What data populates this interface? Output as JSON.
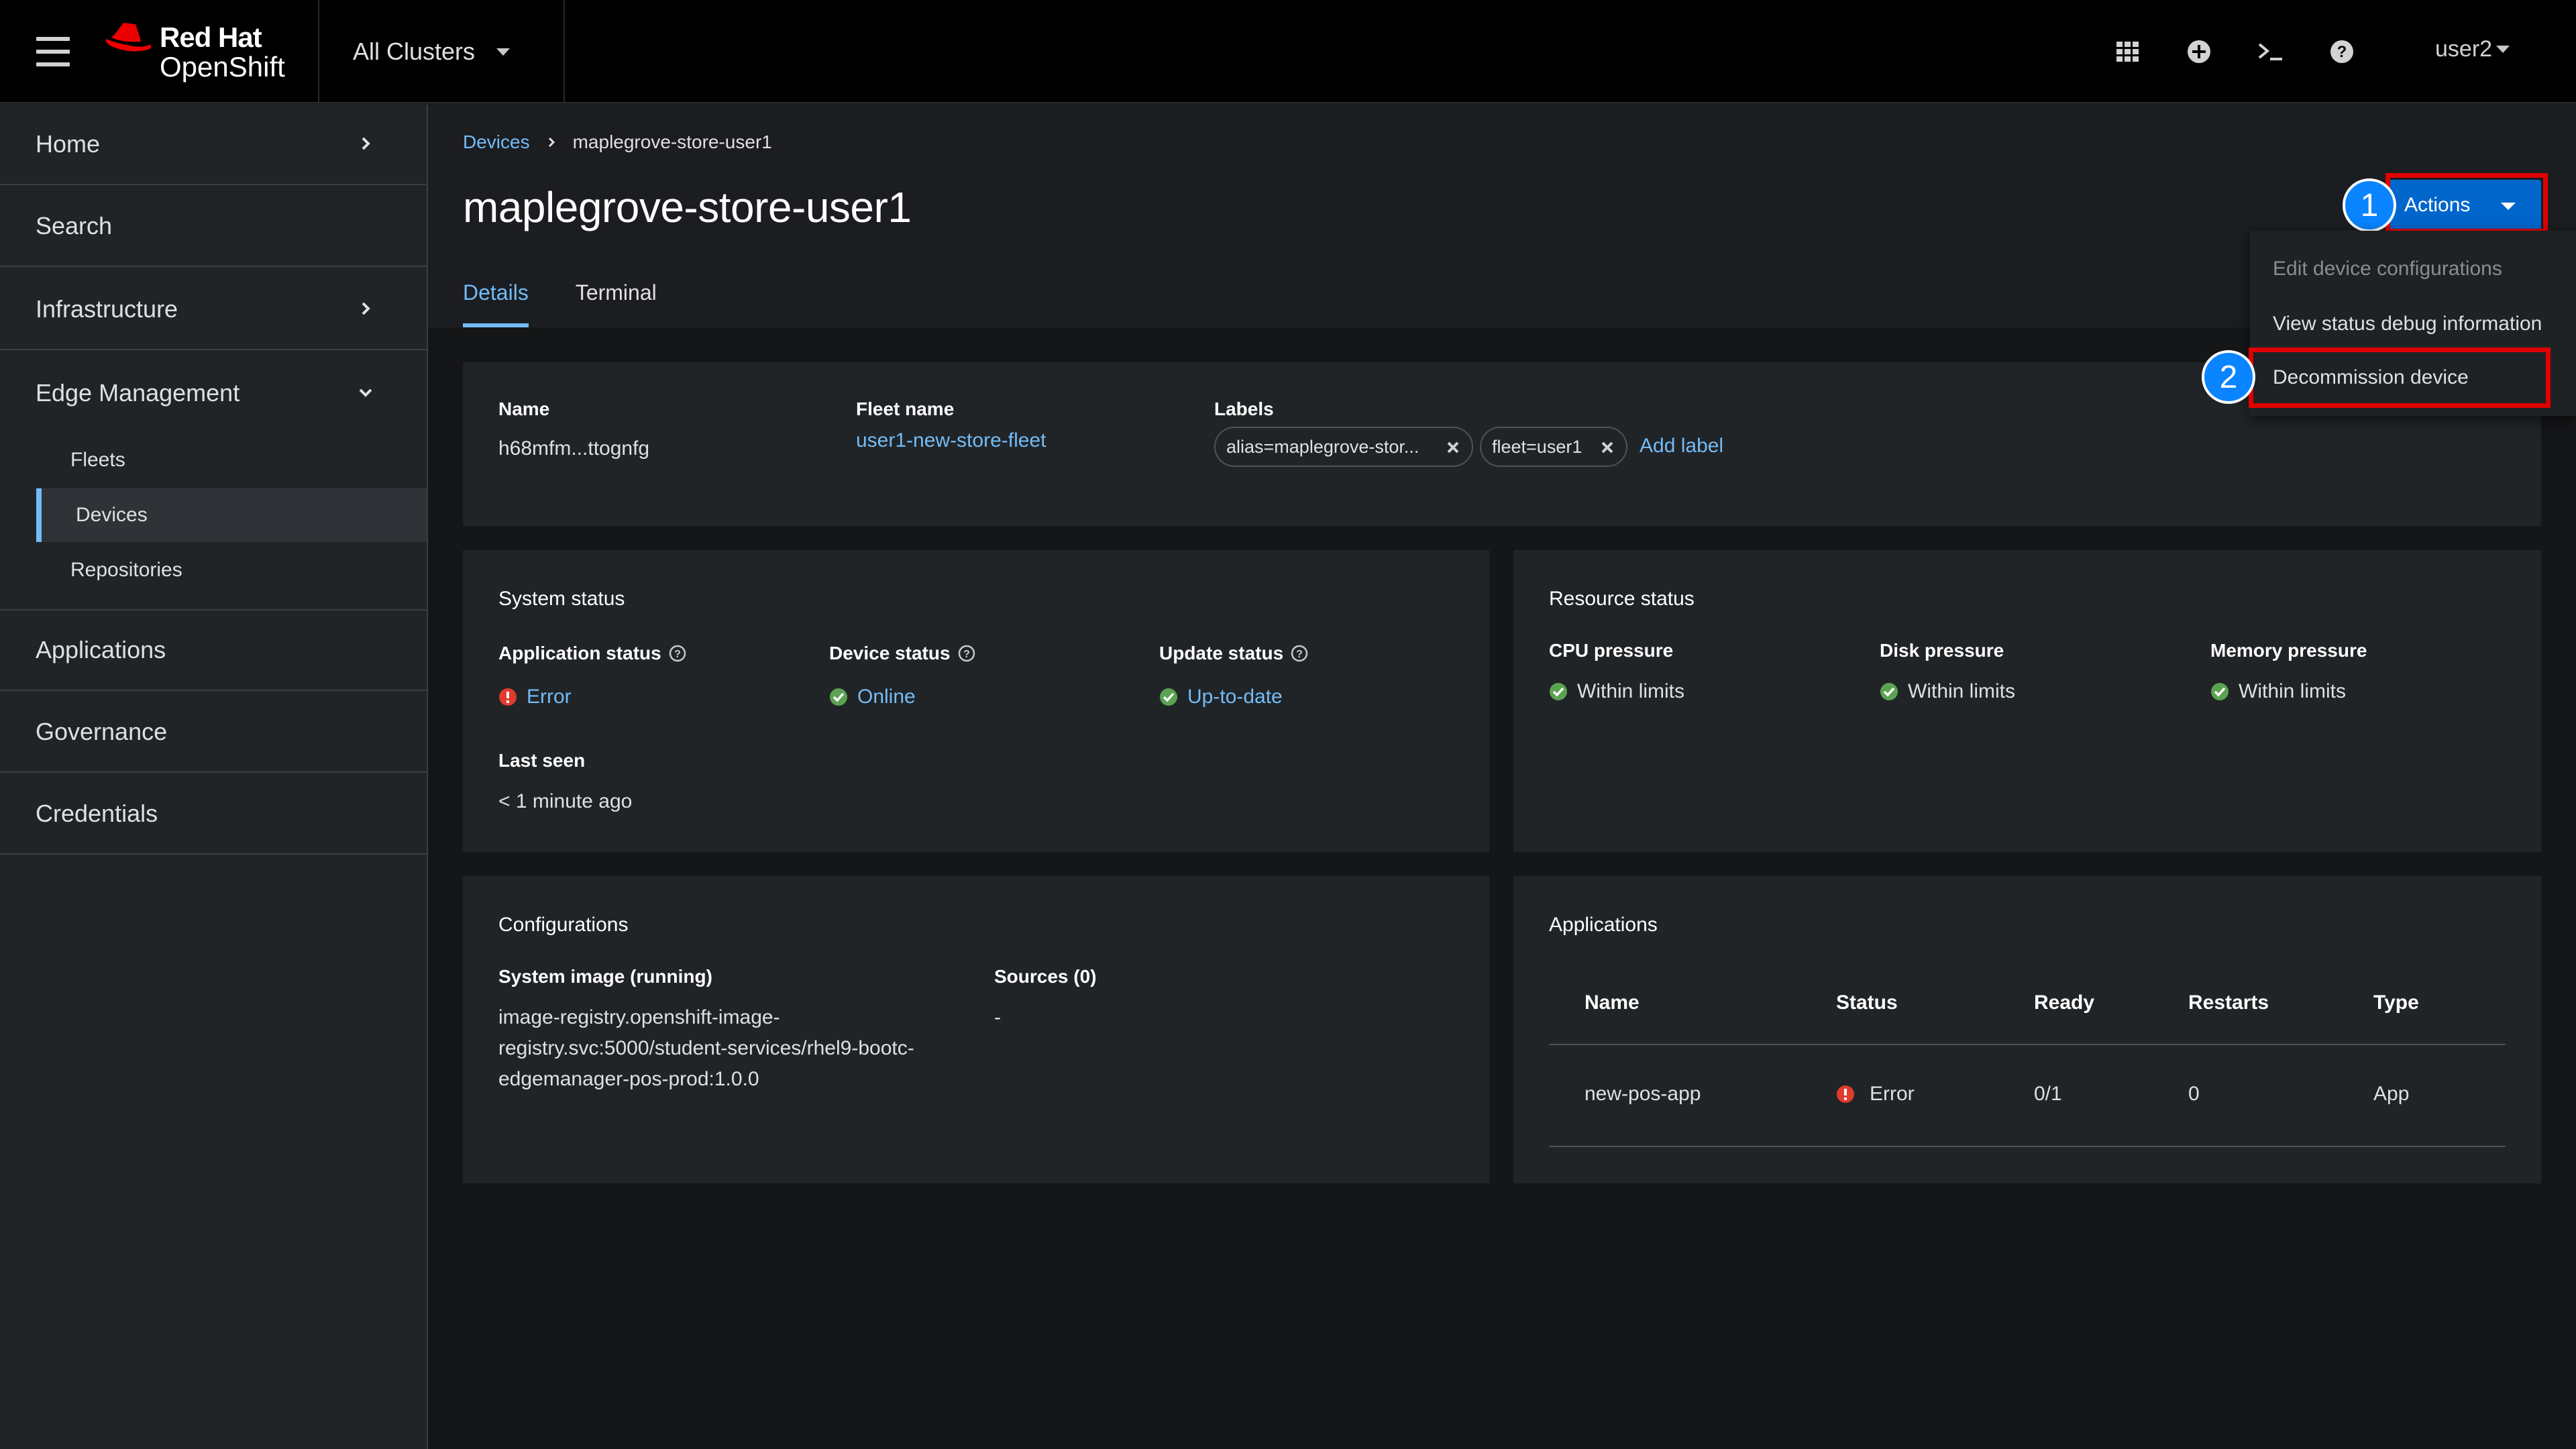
{
  "masthead": {
    "brand_line1": "Red Hat",
    "brand_line2": "OpenShift",
    "cluster_selector": "All Clusters",
    "icons": [
      "grid-apps-icon",
      "plus-circle-icon",
      "terminal-icon",
      "help-icon"
    ],
    "user": "user2"
  },
  "sidebar": {
    "items": [
      {
        "label": "Home",
        "icon": "chevron-right-icon"
      },
      {
        "label": "Search"
      },
      {
        "label": "Infrastructure",
        "icon": "chevron-right-icon"
      },
      {
        "label": "Edge Management",
        "icon": "chevron-down-icon"
      },
      {
        "label": "Applications"
      },
      {
        "label": "Governance"
      },
      {
        "label": "Credentials"
      }
    ],
    "sub_items": [
      {
        "label": "Fleets"
      },
      {
        "label": "Devices",
        "active": true
      },
      {
        "label": "Repositories"
      }
    ]
  },
  "breadcrumb": {
    "parent": "Devices",
    "current": "maplegrove-store-user1"
  },
  "page": {
    "title": "maplegrove-store-user1"
  },
  "tabs": [
    {
      "label": "Details",
      "active": true
    },
    {
      "label": "Terminal"
    }
  ],
  "actions": {
    "label": "Actions",
    "menu": [
      {
        "label": "Edit device configurations",
        "disabled": true
      },
      {
        "label": "View status debug information"
      },
      {
        "label": "Decommission device"
      }
    ],
    "callouts": [
      "1",
      "2"
    ],
    "highlight_color": "#e00000",
    "callout_color": "#0a84ff"
  },
  "details": {
    "name_label": "Name",
    "name_value": "h68mfm...ttognfg",
    "fleet_label": "Fleet name",
    "fleet_value": "user1-new-store-fleet",
    "labels_label": "Labels",
    "labels": [
      "alias=maplegrove-stor...",
      "fleet=user1"
    ],
    "add_label": "Add label"
  },
  "system_status": {
    "title": "System status",
    "app_status_label": "Application status",
    "app_status_value": "Error",
    "device_status_label": "Device status",
    "device_status_value": "Online",
    "update_status_label": "Update status",
    "update_status_value": "Up-to-date",
    "last_seen_label": "Last seen",
    "last_seen_value": "< 1 minute ago"
  },
  "resource_status": {
    "title": "Resource status",
    "cpu_label": "CPU pressure",
    "cpu_value": "Within limits",
    "disk_label": "Disk pressure",
    "disk_value": "Within limits",
    "memory_label": "Memory pressure",
    "memory_value": "Within limits"
  },
  "configurations": {
    "title": "Configurations",
    "system_image_label": "System image (running)",
    "system_image_line1": "image-registry.openshift-image-",
    "system_image_line2": "registry.svc:5000/student-services/rhel9-bootc-",
    "system_image_line3": "edgemanager-pos-prod:1.0.0",
    "sources_label": "Sources (0)",
    "sources_value": "-"
  },
  "applications": {
    "title": "Applications",
    "columns": [
      "Name",
      "Status",
      "Ready",
      "Restarts",
      "Type"
    ],
    "rows": [
      {
        "name": "new-pos-app",
        "status": "Error",
        "ready": "0/1",
        "restarts": "0",
        "type": "App"
      }
    ]
  },
  "colors": {
    "link": "#73bcf7",
    "success": "#3e8635",
    "danger": "#c9190b",
    "primary_button": "#0066cc"
  }
}
